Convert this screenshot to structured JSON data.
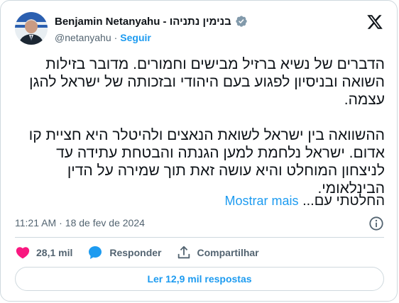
{
  "author": {
    "name": "Benjamin Netanyahu - בנימין נתניהו",
    "handle": "@netanyahu",
    "separator": "·",
    "follow_label": "Seguir"
  },
  "tweet": {
    "paragraph_1": "הדברים של נשיא ברזיל מבישים וחמורים. מדובר בזילות השואה ובניסיון לפגוע בעם היהודי ובזכותה של ישראל להגן עצמה.",
    "paragraph_2": "ההשוואה בין ישראל לשואת הנאצים ולהיטלר היא חציית קו אדום. ישראל נלחמת למען הגנתה והבטחת עתידה עד לניצחון המוחלט והיא עושה זאת תוך שמירה על הדין הבינלאומי.",
    "paragraph_3_fragment": "החלטתי עם...",
    "show_more_label": "Mostrar mais"
  },
  "meta": {
    "time": "11:21 AM",
    "separator": "·",
    "date": "18 de fev de 2024"
  },
  "actions": {
    "likes": "28,1 mil",
    "reply_label": "Responder",
    "share_label": "Compartilhar"
  },
  "read_replies_label": "Ler 12,9 mil respostas",
  "colors": {
    "accent": "#1d9bf0",
    "like": "#f91880",
    "text": "#0f1419",
    "muted": "#536471",
    "border": "#cfd9de"
  },
  "icons": {
    "verified": "verified-badge-icon",
    "brand": "x-logo-icon",
    "info": "info-icon",
    "like": "heart-icon",
    "reply": "reply-bubble-icon",
    "share": "share-icon"
  }
}
